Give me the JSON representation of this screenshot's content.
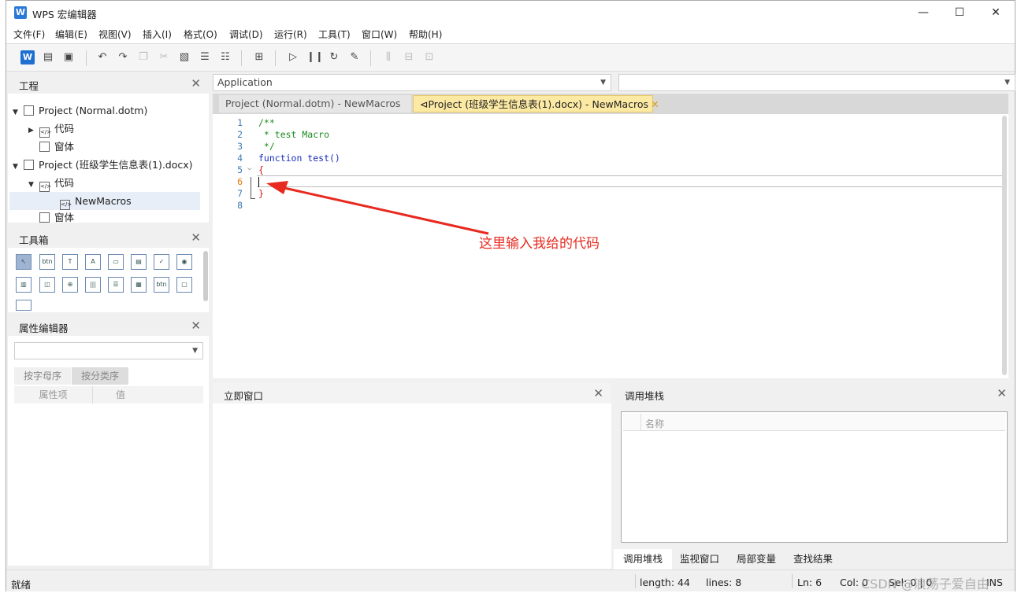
{
  "window": {
    "title": "WPS 宏编辑器",
    "minimize": "—",
    "maximize": "☐",
    "close": "✕"
  },
  "menu": [
    "文件(F)",
    "编辑(E)",
    "视图(V)",
    "插入(I)",
    "格式(O)",
    "调试(D)",
    "运行(R)",
    "工具(T)",
    "窗口(W)",
    "帮助(H)"
  ],
  "toolbar_icons": [
    "wps-logo-icon",
    "new-module-icon",
    "save-icon",
    "undo-icon",
    "redo-icon",
    "copy-icon",
    "cut-icon",
    "paste-icon",
    "comment-icon",
    "uncomment-icon",
    "insert-userform-icon",
    "run-icon",
    "pause-icon",
    "reset-icon",
    "design-mode-icon",
    "align-icon",
    "center-icon",
    "distribute-icon"
  ],
  "project_panel": {
    "title": "工程",
    "tree": [
      {
        "label": "Project (Normal.dotm)",
        "level": 0,
        "expanded": true
      },
      {
        "label": "代码",
        "level": 1,
        "expanded": false
      },
      {
        "label": "窗体",
        "level": 1
      },
      {
        "label": "Project (班级学生信息表(1).docx)",
        "level": 0,
        "expanded": true
      },
      {
        "label": "代码",
        "level": 1,
        "expanded": true
      },
      {
        "label": "NewMacros",
        "level": 2,
        "selected": true
      },
      {
        "label": "窗体",
        "level": 1
      }
    ]
  },
  "toolbox_panel": {
    "title": "工具箱",
    "tools": [
      "pointer",
      "btn",
      "T",
      "A",
      "frame",
      "combobox",
      "checkbox",
      "radio",
      "listbox",
      "spin",
      "scroll",
      "hscroll",
      "vscroll",
      "image",
      "btn2",
      "image2",
      "tabstrip"
    ]
  },
  "props_panel": {
    "title": "属性编辑器",
    "tab_alpha": "按字母序",
    "tab_cat": "按分类序",
    "col_prop": "属性项",
    "col_val": "值"
  },
  "editor": {
    "object_combo": "Application",
    "proc_combo": "",
    "tabs": [
      {
        "label": "Project (Normal.dotm) - NewMacros",
        "active": false
      },
      {
        "label": "Project (班级学生信息表(1).docx) - NewMacros",
        "active": true
      }
    ],
    "lines": [
      "/**",
      " * test Macro",
      " */",
      "function test()",
      "{",
      "",
      "}",
      ""
    ],
    "line_numbers": [
      "1",
      "2",
      "3",
      "4",
      "5",
      "6",
      "7",
      "8"
    ]
  },
  "annotation": "这里输入我给的代码",
  "immediate": {
    "title": "立即窗口"
  },
  "callstack": {
    "title": "调用堆栈",
    "col_name": "名称"
  },
  "bottom_tabs": [
    "调用堆栈",
    "监视窗口",
    "局部变量",
    "查找结果"
  ],
  "status": {
    "ready": "就绪",
    "length": "length: 44",
    "lines": "lines: 8",
    "ln": "Ln: 6",
    "col": "Col: 0",
    "sel": "Sel: 0 | 0",
    "mode": "INS"
  },
  "watermark": "CSDN @浪荡子爱自由"
}
